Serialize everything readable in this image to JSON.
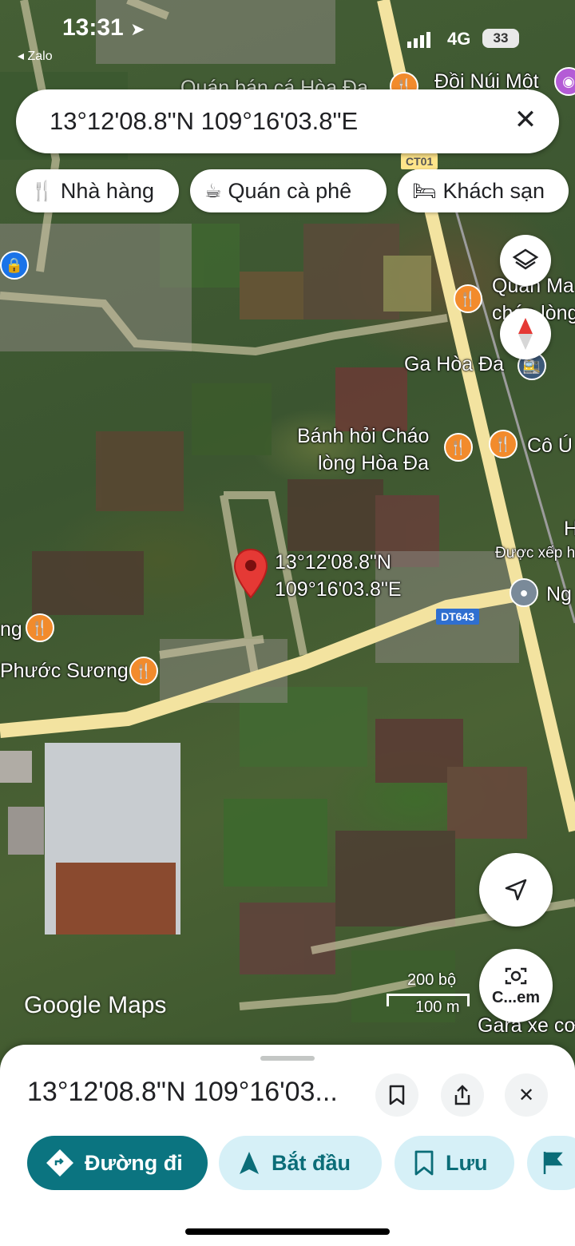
{
  "status_bar": {
    "time": "13:31",
    "back_app": "◂ Zalo",
    "network": "4G",
    "battery": "33"
  },
  "search": {
    "query": "13°12'08.8\"N 109°16'03.8\"E",
    "close_icon": "✕"
  },
  "chips": [
    {
      "icon": "restaurant-icon",
      "glyph": "🍴",
      "label": "Nhà hàng"
    },
    {
      "icon": "cafe-icon",
      "glyph": "☕",
      "label": "Quán cà phê"
    },
    {
      "icon": "hotel-icon",
      "glyph": "🛏",
      "label": "Khách sạn"
    }
  ],
  "map": {
    "pin_label_line1": "13°12'08.8\"N",
    "pin_label_line2": "109°16'03.8\"E",
    "places": {
      "top_cut": "Quán bán cá Hòa Đa",
      "doi_nui_mot": "Đồi Núi Một",
      "quan_ma_1": "Quán Ma",
      "quan_ma_2": "cháo lòng",
      "ga_hoa_da": "Ga Hòa Đa",
      "banh_hoi_1": "Bánh hỏi Cháo",
      "banh_hoi_2": "lòng Hòa Đa",
      "co_u": "Cô Ú",
      "h_label": "H",
      "duoc_xep": "Được xếp h",
      "ng": "Ng",
      "ng_left": "ng",
      "phuoc_suong": "Phước Sương",
      "gara": "Gara xe cơ g"
    },
    "roads": {
      "ct01": "CT01",
      "dt643": "DT643"
    },
    "logo": "Google Maps",
    "scale_top": "200 bộ",
    "scale_bottom": "100 m",
    "camera_label": "C...em",
    "colors": {
      "road": "#f3e3a0",
      "pin": "#e53935",
      "poi": "#f28b2c"
    }
  },
  "sheet": {
    "title": "13°12'08.8\"N 109°16'03...",
    "actions": {
      "directions": "Đường đi",
      "start": "Bắt đầu",
      "save": "Lưu"
    },
    "colors": {
      "primary": "#0b7480",
      "secondary": "#d6f0f7"
    }
  }
}
